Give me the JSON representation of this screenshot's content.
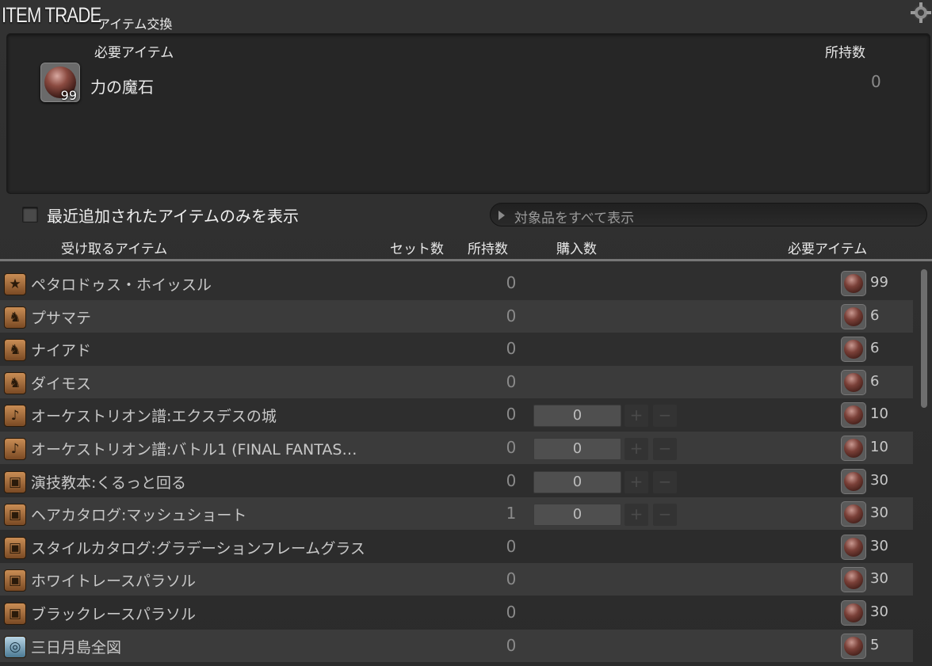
{
  "window": {
    "title": "ITEM TRADE",
    "subtitle": "アイテム交換"
  },
  "required_panel": {
    "header_item": "必要アイテム",
    "header_owned": "所持数",
    "item_name": "力の魔石",
    "item_quantity": "99",
    "owned": "0"
  },
  "filter": {
    "checkbox_label": "最近追加されたアイテムのみを表示",
    "checked": false,
    "show_all_label": "対象品をすべて表示"
  },
  "columns": {
    "receive_item": "受け取るアイテム",
    "set_count": "セット数",
    "owned": "所持数",
    "purchase": "購入数",
    "required": "必要アイテム"
  },
  "rows": [
    {
      "icon": "star-icon",
      "name": "ペタロドゥス・ホイッスル",
      "owned": "0",
      "purchase": null,
      "cost": "99"
    },
    {
      "icon": "mount-icon",
      "name": "プサマテ",
      "owned": "0",
      "purchase": null,
      "cost": "6"
    },
    {
      "icon": "mount-icon",
      "name": "ナイアド",
      "owned": "0",
      "purchase": null,
      "cost": "6"
    },
    {
      "icon": "mount-icon",
      "name": "ダイモス",
      "owned": "0",
      "purchase": null,
      "cost": "6"
    },
    {
      "icon": "music-note-icon",
      "name": "オーケストリオン譜:エクスデスの城",
      "owned": "0",
      "purchase": "0",
      "cost": "10"
    },
    {
      "icon": "music-note-icon",
      "name": "オーケストリオン譜:バトル1 (FINAL FANTAS…",
      "owned": "0",
      "purchase": "0",
      "cost": "10"
    },
    {
      "icon": "chest-icon",
      "name": "演技教本:くるっと回る",
      "owned": "0",
      "purchase": "0",
      "cost": "30"
    },
    {
      "icon": "chest-icon",
      "name": "ヘアカタログ:マッシュショート",
      "owned": "1",
      "purchase": "0",
      "cost": "30"
    },
    {
      "icon": "chest-icon",
      "name": "スタイルカタログ:グラデーションフレームグラス",
      "owned": "0",
      "purchase": null,
      "cost": "30"
    },
    {
      "icon": "chest-icon",
      "name": "ホワイトレースパラソル",
      "owned": "0",
      "purchase": null,
      "cost": "30"
    },
    {
      "icon": "chest-icon",
      "name": "ブラックレースパラソル",
      "owned": "0",
      "purchase": null,
      "cost": "30"
    },
    {
      "icon": "map-icon",
      "name": "三日月島全図",
      "owned": "0",
      "purchase": null,
      "cost": "5"
    }
  ],
  "icons": {
    "star-icon": "★",
    "mount-icon": "♞",
    "music-note-icon": "♪",
    "chest-icon": "▣",
    "map-icon": "◎"
  },
  "stepper": {
    "plus": "+",
    "minus": "−"
  },
  "colors": {
    "background": "#2b2b2b",
    "row_alt": "#3b3b3b",
    "text": "#c8c8c8",
    "muted": "#8a8a8a"
  }
}
